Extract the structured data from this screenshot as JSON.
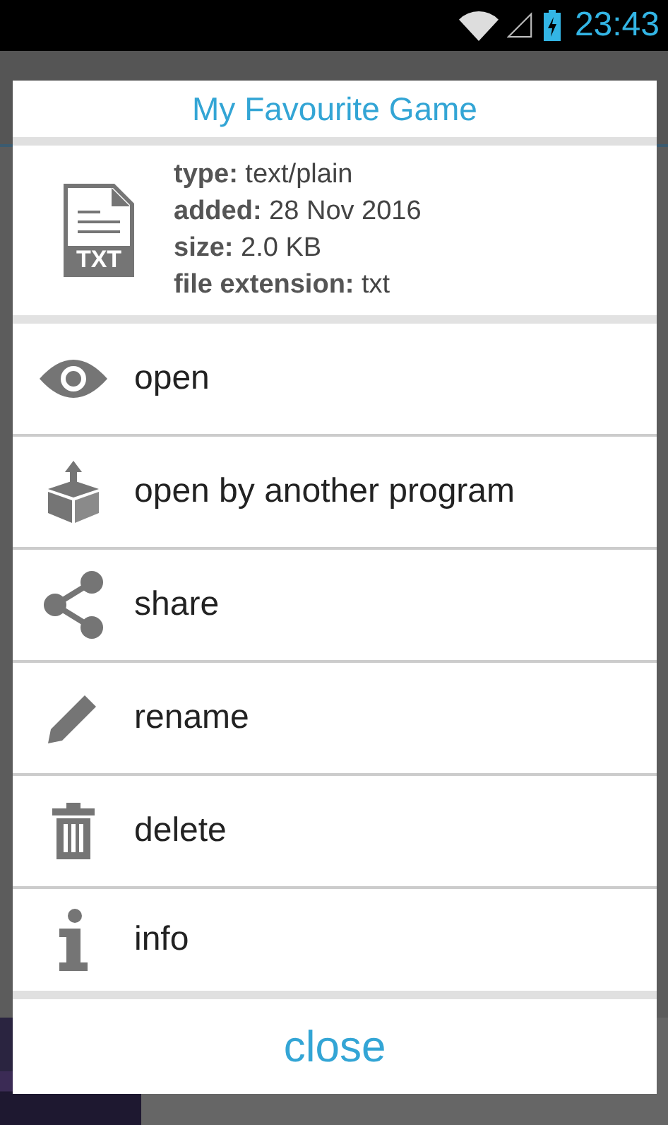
{
  "status_bar": {
    "time": "23:43"
  },
  "dialog": {
    "title": "My Favourite Game",
    "file_info": [
      {
        "label": "type:",
        "value": "text/plain"
      },
      {
        "label": "added:",
        "value": "28 Nov 2016"
      },
      {
        "label": "size:",
        "value": "2.0 KB"
      },
      {
        "label": "file extension:",
        "value": "txt"
      }
    ],
    "file_icon_label": "TXT",
    "actions": [
      {
        "kind": "eye",
        "label": "open"
      },
      {
        "kind": "box",
        "label": "open by another program"
      },
      {
        "kind": "share",
        "label": "share"
      },
      {
        "kind": "pencil",
        "label": "rename"
      },
      {
        "kind": "trash",
        "label": "delete"
      },
      {
        "kind": "info",
        "label": "info"
      }
    ],
    "close_button": "close"
  }
}
